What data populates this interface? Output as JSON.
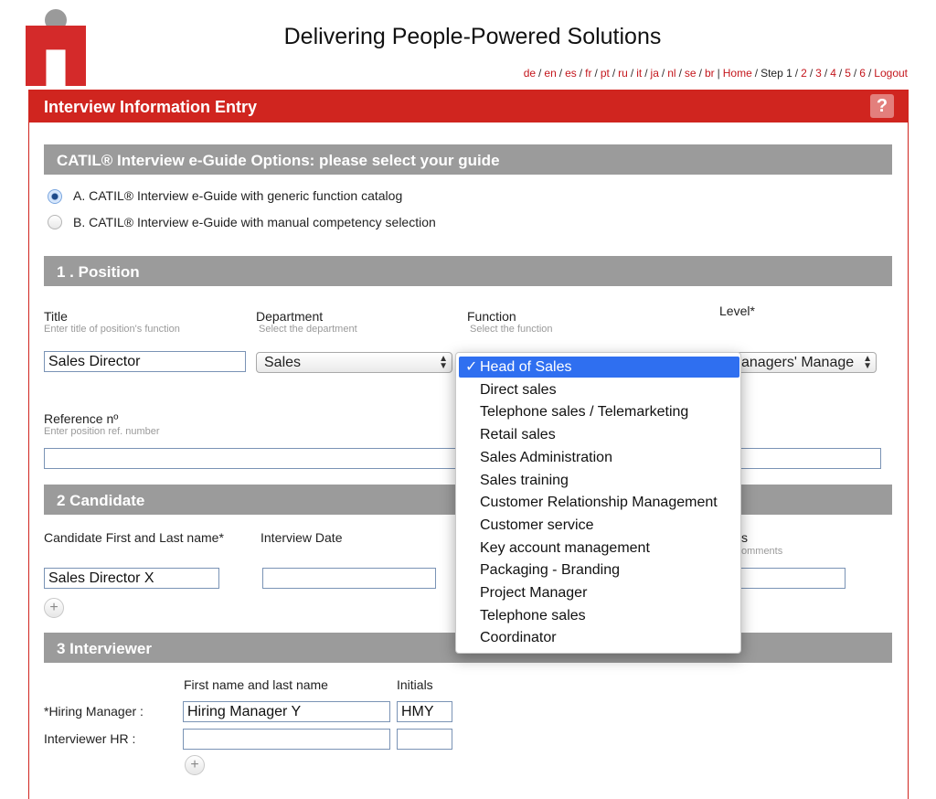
{
  "header": {
    "tagline": "Delivering People-Powered Solutions",
    "languages": [
      "de",
      "en",
      "es",
      "fr",
      "pt",
      "ru",
      "it",
      "ja",
      "nl",
      "se",
      "br"
    ],
    "home": "Home",
    "step_current": "Step 1",
    "steps": [
      "2",
      "3",
      "4",
      "5",
      "6"
    ],
    "logout": "Logout"
  },
  "page": {
    "title": "Interview Information Entry",
    "help": "?"
  },
  "guide": {
    "heading": "CATIL® Interview e-Guide Options: please select your guide",
    "option_a": "A. CATIL® Interview e-Guide with generic function catalog",
    "option_b": "B. CATIL® Interview e-Guide with manual competency selection",
    "selected": "A"
  },
  "position": {
    "heading": "1 . Position",
    "title_label": "Title",
    "title_hint": "Enter title of position's function",
    "title_value": "Sales Director",
    "department_label": "Department",
    "department_hint": "Select the department",
    "department_value": "Sales",
    "function_label": "Function",
    "function_hint": "Select the function",
    "level_label": "Level*",
    "level_value": "anagers' Manage",
    "reference_label": "Reference nº",
    "reference_hint": "Enter position ref. number",
    "reference_value": ""
  },
  "function_dropdown": {
    "check": "✓",
    "selected": "Head of Sales",
    "options": [
      "Head of Sales",
      "Direct sales",
      "Telephone sales / Telemarketing",
      "Retail sales",
      "Sales Administration",
      "Sales training",
      "Customer Relationship Management",
      "Customer service",
      "Key account management",
      "Packaging - Branding",
      "Project Manager",
      "Telephone sales",
      "Coordinator"
    ]
  },
  "candidate": {
    "heading": "2 Candidate",
    "name_label": "Candidate First and Last name*",
    "name_value": "Sales Director X",
    "date_label": "Interview Date",
    "date_value": "",
    "observations_label_partial": "s",
    "observations_hint_partial": "omments",
    "add": "+"
  },
  "interviewer": {
    "heading": "3 Interviewer",
    "col_name": "First name and last name",
    "col_initials": "Initials",
    "hiring_manager_label": "*Hiring Manager :",
    "hiring_manager_name": "Hiring Manager Y",
    "hiring_manager_initials": "HMY",
    "hr_label": "Interviewer HR :",
    "hr_name": "",
    "hr_initials": "",
    "add": "+"
  },
  "colors": {
    "brand_red": "#d0251f",
    "section_gray": "#9b9b9b",
    "select_blue": "#2f6ff0"
  }
}
